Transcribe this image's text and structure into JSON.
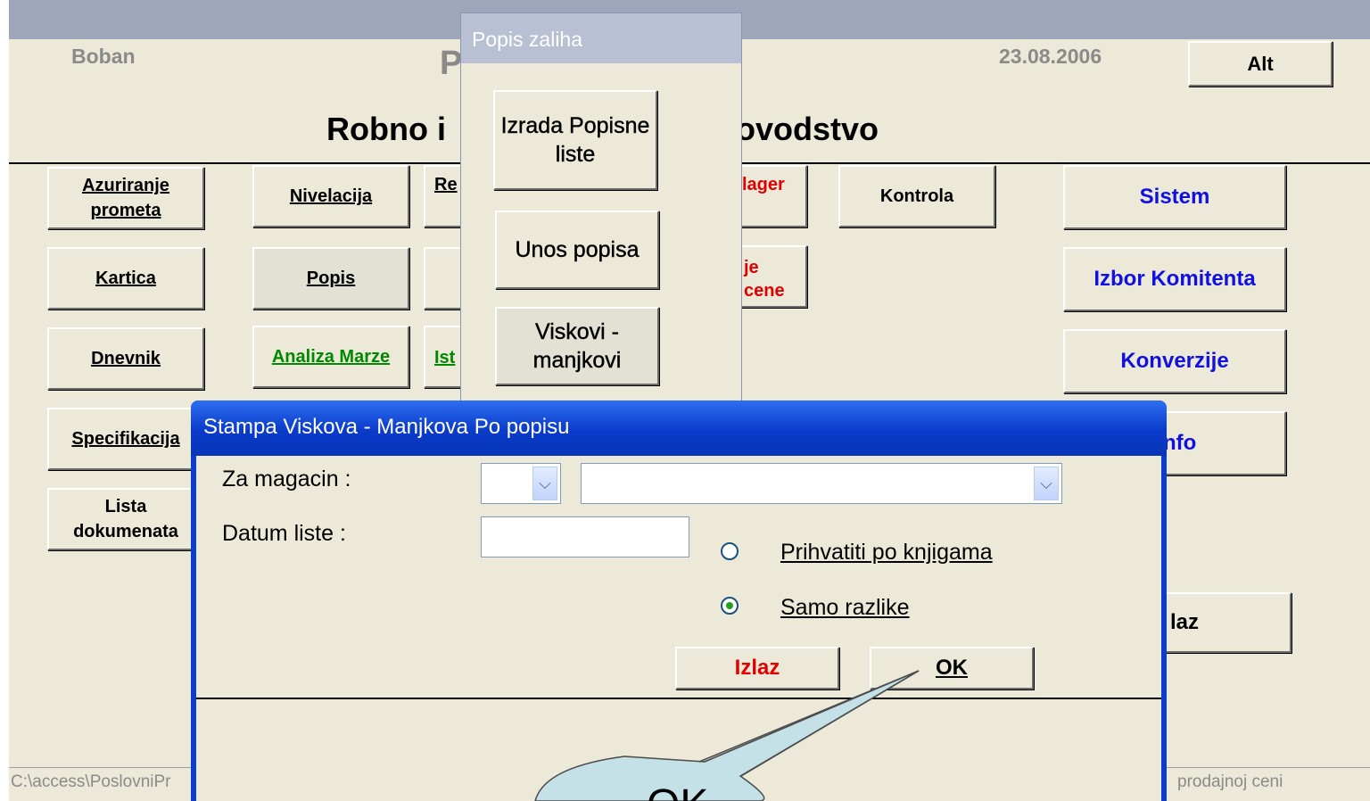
{
  "header": {
    "user": "Boban",
    "date": "23.08.2006",
    "alt_button": "Alt",
    "title_left": "Robno i",
    "title_right": "ovodstvo",
    "title_fragment": "P"
  },
  "left_buttons": {
    "azuriranje": "Azuriranje prometa",
    "kartica": "Kartica",
    "dnevnik": "Dnevnik",
    "specifikacija": "Specifikacija",
    "lista": "Lista dokumenata"
  },
  "mid_buttons": {
    "nivelacija": "Nivelacija",
    "popis": "Popis",
    "analiza": "Analiza Marze",
    "re_fragment": "Re",
    "ist_fragment": "Ist",
    "lager_fragment": "lager",
    "je_fragment": "je",
    "cene_fragment": "cene",
    "kontrola": "Kontrola"
  },
  "right_buttons": {
    "sistem": "Sistem",
    "izbor": "Izbor Komitenta",
    "konverzije": "Konverzije",
    "info_fragment": "nfo",
    "izlaz_fragment": "laz"
  },
  "status_bar": {
    "path": "C:\\access\\PoslovniPr",
    "right": "prodajnoj ceni"
  },
  "popis_window": {
    "title": "Popis zaliha",
    "izrada": "Izrada Popisne liste",
    "unos": "Unos popisa",
    "viskovi": "Viskovi - manjkovi"
  },
  "dialog": {
    "title": "Stampa Viskova - Manjkova Po popisu",
    "magacin_label": "Za magacin :",
    "datum_label": "Datum liste :",
    "magacin_code": "",
    "magacin_name": "",
    "datum_value": "",
    "radio_knjige": "Prihvatiti po knjigama",
    "radio_razlike": "Samo razlike",
    "izlaz_button": "Izlaz",
    "ok_button": "OK"
  },
  "callout": {
    "text": "OK"
  },
  "colors": {
    "face": "#ECE9D8",
    "title_blue": "#0A3EC9",
    "text_blue": "#1010E0",
    "text_green": "#008800",
    "text_red": "#E00000",
    "callout_fill": "#C4E1E7"
  }
}
